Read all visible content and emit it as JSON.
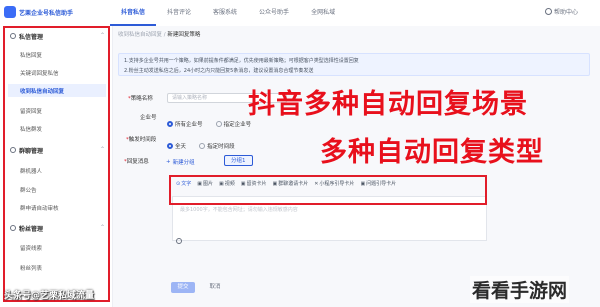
{
  "app": {
    "brand": "艺栗企业号私信助手",
    "help": "帮助中心"
  },
  "nav": {
    "tabs": [
      "抖音私信",
      "抖音评论",
      "客服系统",
      "公众号助手",
      "全网私域"
    ]
  },
  "sidebar": {
    "sections": [
      {
        "title": "私信管理",
        "items": [
          "私信回复",
          "关键词回复私信",
          "收到私信自动回复",
          "留资回复",
          "私信群发"
        ]
      },
      {
        "title": "群聊管理",
        "items": [
          "群机器人",
          "群公告",
          "群申请自动审核"
        ]
      },
      {
        "title": "粉丝管理",
        "items": [
          "留资线索",
          "粉丝列表"
        ]
      }
    ]
  },
  "breadcrumb": {
    "parent": "收到私信自动回复",
    "sep": "/",
    "current": "新建回复策略"
  },
  "notice": {
    "line1": "1.支持多企业号共用一个策略，如果前提条件都满足，优先使用最新策略；可根据客户类型选择性设置回复",
    "line2": "2.粉丝主动发送私信之后，24小时之内只能回复5条消息，建议设置消息合理节奏发送"
  },
  "form": {
    "rule_name_label": "策略名称",
    "rule_name_placeholder": "请输入策略名称",
    "account_label": "企业号",
    "account_options": [
      "所有企业号",
      "指定企业号"
    ],
    "time_label": "触发时间段",
    "time_options": [
      "全天",
      "指定时间段"
    ],
    "reply_label": "回复消息",
    "add_group": "新建分组",
    "group_chip": "分组1"
  },
  "message_types": [
    "文字",
    "图片",
    "视频",
    "留资卡片",
    "群聊邀请卡片",
    "小程序引导卡片",
    "问题引导卡片"
  ],
  "editor": {
    "placeholder": "最多1000字，不能包含网址；请勿输入违规敏感内容"
  },
  "buttons": {
    "confirm": "提交",
    "cancel": "取消"
  },
  "overlay": {
    "line1": "抖音多种自动回复场景",
    "line2": "多种自动回复类型"
  },
  "watermarks": {
    "left": "头条号@艺栗私域流量",
    "right": "看看手游网"
  },
  "colors": {
    "accent": "#2d5bd7",
    "highlight_red": "#e11d2a"
  }
}
